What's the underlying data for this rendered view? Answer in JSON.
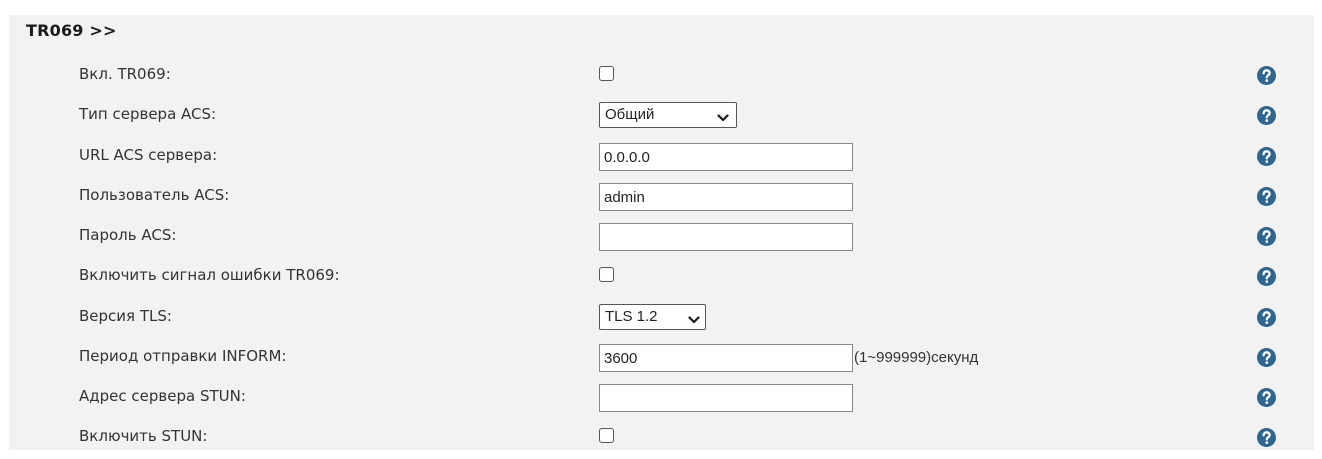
{
  "section": {
    "title": "TR069 >>"
  },
  "colors": {
    "panel_bg": "#f2f2f2",
    "help_icon": "#2f6591",
    "text": "#333333"
  },
  "fields": {
    "enable_tr069": {
      "label": "Вкл. TR069:",
      "checked": false,
      "help_icon": "help-icon"
    },
    "acs_server_type": {
      "label": "Тип сервера ACS:",
      "value": "Общий",
      "help_icon": "help-icon"
    },
    "acs_url": {
      "label": "URL ACS сервера:",
      "value": "0.0.0.0",
      "help_icon": "help-icon"
    },
    "acs_user": {
      "label": "Пользователь ACS:",
      "value": "admin",
      "help_icon": "help-icon"
    },
    "acs_password": {
      "label": "Пароль ACS:",
      "value": "",
      "help_icon": "help-icon"
    },
    "tr069_error_signal": {
      "label": "Включить сигнал ошибки TR069:",
      "checked": false,
      "help_icon": "help-icon"
    },
    "tls_version": {
      "label": "Версия TLS:",
      "value": "TLS 1.2",
      "help_icon": "help-icon"
    },
    "inform_period": {
      "label": "Период отправки INFORM:",
      "value": "3600",
      "unit": "(1~999999)секунд",
      "help_icon": "help-icon"
    },
    "stun_server": {
      "label": "Адрес сервера STUN:",
      "value": "",
      "help_icon": "help-icon"
    },
    "enable_stun": {
      "label": "Включить STUN:",
      "checked": false,
      "help_icon": "help-icon"
    }
  }
}
